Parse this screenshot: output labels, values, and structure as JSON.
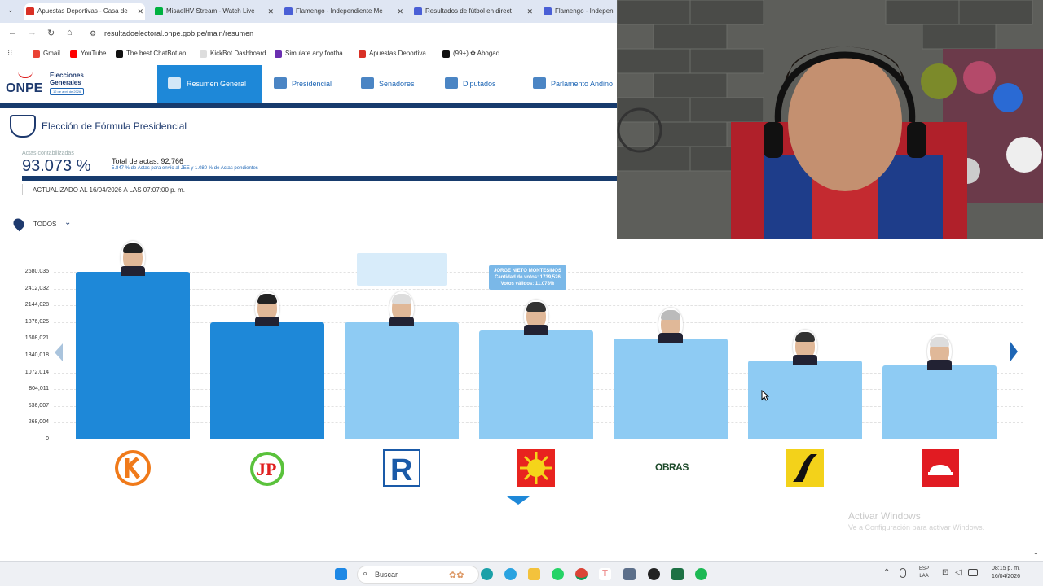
{
  "browser": {
    "tabs": [
      {
        "title": "Apuestas Deportivas - Casa de",
        "color": "#d93025"
      },
      {
        "title": "MisaelHV Stream - Watch Live",
        "color": "#00b140"
      },
      {
        "title": "Flamengo - Independiente Me",
        "color": "#4a5fd6"
      },
      {
        "title": "Resultados de fútbol en direct",
        "color": "#4a5fd6"
      },
      {
        "title": "Flamengo - Indepen",
        "color": "#4a5fd6"
      }
    ],
    "url": "resultadoelectoral.onpe.gob.pe/main/resumen",
    "bookmarks": [
      {
        "label": "Gmail",
        "color": "#ea4335"
      },
      {
        "label": "YouTube",
        "color": "#ff0000"
      },
      {
        "label": "The best ChatBot an...",
        "color": "#111111"
      },
      {
        "label": "KickBot Dashboard",
        "color": "#eeeeee"
      },
      {
        "label": "Simulate any footba...",
        "color": "#6a2fb0"
      },
      {
        "label": "Apuestas Deportiva...",
        "color": "#d93025"
      },
      {
        "label": "(99+) ✿ Abogad...",
        "color": "#111111"
      }
    ]
  },
  "header": {
    "logo_text": "ONPE",
    "logo_sub": "Elecciones Generales",
    "logo_date": "12 de abril de 2026",
    "nav": [
      {
        "label": "Resumen General"
      },
      {
        "label": "Presidencial"
      },
      {
        "label": "Senadores"
      },
      {
        "label": "Diputados"
      },
      {
        "label": "Parlamento Andino"
      }
    ]
  },
  "summary": {
    "title": "Elección de Fórmula Presidencial",
    "actas_label": "Actas contabilizadas",
    "actas_pct": "93.073 %",
    "total_actas": "Total de actas: 92,766",
    "actas_detail": "5.847 % de Actas para envío al JEE y 1.080 % de Actas pendientes",
    "updated": "ACTUALIZADO AL 16/04/2026 A LAS 07:07:00 p. m.",
    "filter": "TODOS"
  },
  "chart_data": {
    "type": "bar",
    "ylim": [
      0,
      2680035
    ],
    "yticks": [
      "2680,035",
      "2412,032",
      "2144,028",
      "1876,025",
      "1608,021",
      "1340,018",
      "1072,014",
      "804,011",
      "536,007",
      "268,004",
      "0"
    ],
    "values": [
      2680035,
      1876025,
      1876025,
      1739526,
      1608021,
      1260000,
      1180000
    ],
    "colors": [
      "#1e88d8",
      "#1e88d8",
      "#8ecbf3",
      "#8ecbf3",
      "#8ecbf3",
      "#8ecbf3",
      "#8ecbf3"
    ],
    "tooltips": [
      {
        "line1": "JORGE NIETO MONTESINOS",
        "line2": "Cantidad de votos: 1739,526",
        "line3": "Votos válidos: 11.078%"
      }
    ],
    "party_logos": [
      "fuerza-popular-logo",
      "juntos-por-el-peru-logo",
      "renovacion-popular-logo",
      "partido-del-buen-gobierno-logo",
      "obras-logo",
      "pais-para-todos-logo",
      "red-party-logo"
    ],
    "obras_text": "OBRAS"
  },
  "windows": {
    "watermark_title": "Activar Windows",
    "watermark_sub": "Ve a Configuración para activar Windows.",
    "search": "Buscar",
    "lang": [
      "ESP",
      "LAA"
    ],
    "time": "08:15 p. m.",
    "date": "16/04/2026"
  }
}
